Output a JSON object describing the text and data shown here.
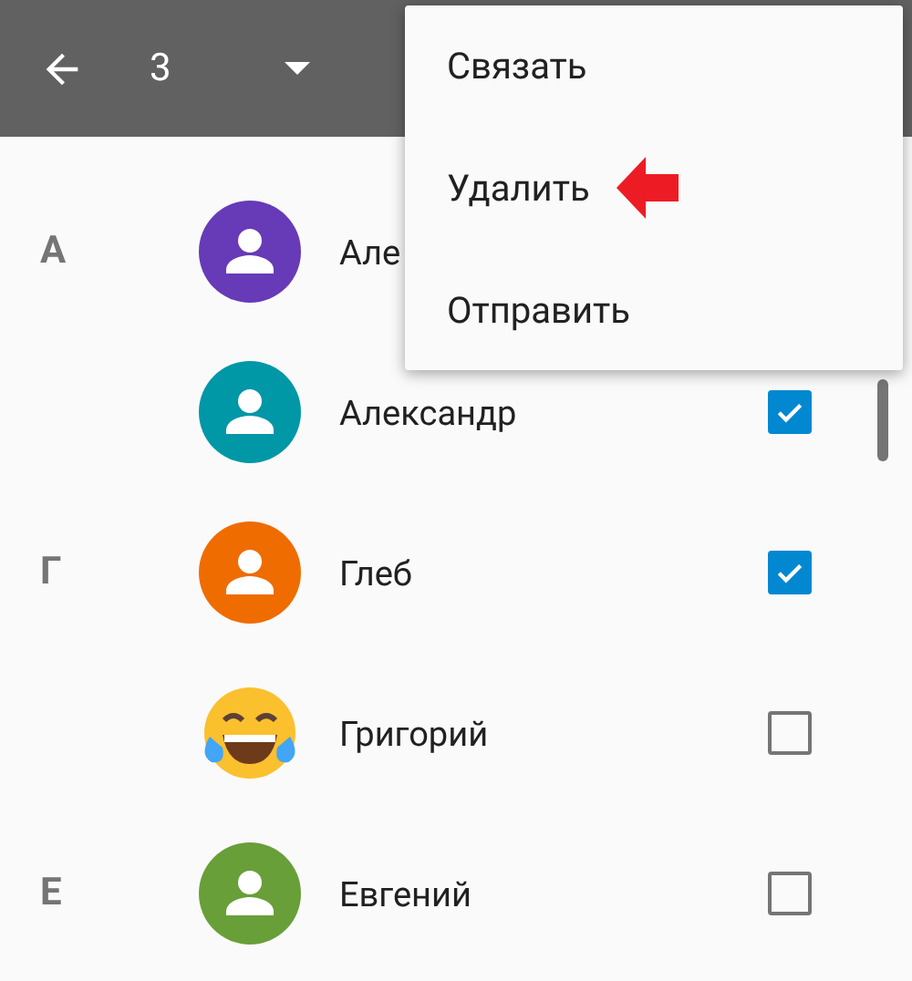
{
  "toolbar": {
    "count": "3"
  },
  "contacts": [
    {
      "section": "A",
      "name": "Але",
      "avatar": {
        "kind": "person",
        "color": "#673ab7"
      }
    },
    {
      "name": "Александр",
      "avatar": {
        "kind": "person",
        "color": "#0097a7"
      },
      "checked": true
    },
    {
      "section": "Г",
      "name": "Глеб",
      "avatar": {
        "kind": "person",
        "color": "#ef6c00"
      },
      "checked": true
    },
    {
      "name": "Григорий",
      "avatar": {
        "kind": "emoji"
      },
      "checked": false
    },
    {
      "section": "Е",
      "name": "Евгений",
      "avatar": {
        "kind": "person",
        "color": "#689f38"
      },
      "checked": false
    }
  ],
  "menu": [
    {
      "label": "Связать",
      "marked": false
    },
    {
      "label": "Удалить",
      "marked": true
    },
    {
      "label": "Отправить",
      "marked": false
    }
  ]
}
